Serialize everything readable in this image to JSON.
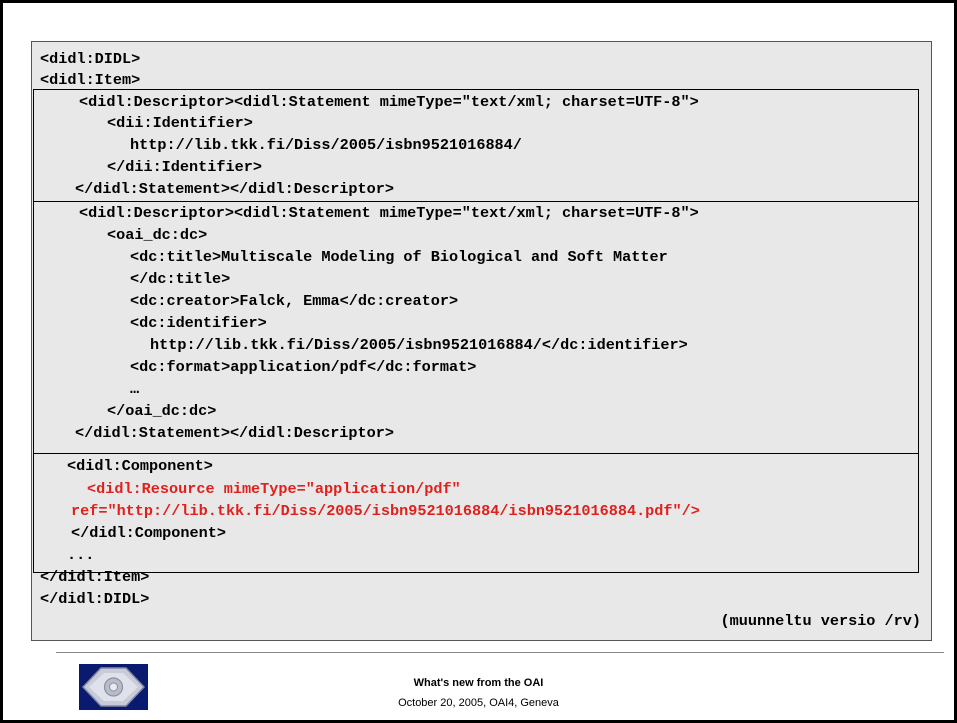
{
  "slide": {
    "code_lines": [
      {
        "text": "<didl:DIDL>",
        "color": "#000000"
      },
      {
        "text": "<didl:Item>",
        "color": "#000000"
      },
      {
        "text": "<didl:Descriptor><didl:Statement mimeType=\"text/xml; charset=UTF-8\">",
        "color": "#000000"
      },
      {
        "text": "<dii:Identifier>",
        "color": "#000000"
      },
      {
        "text": "http://lib.tkk.fi/Diss/2005/isbn9521016884/",
        "color": "#000000"
      },
      {
        "text": "</dii:Identifier>",
        "color": "#000000"
      },
      {
        "text": "</didl:Statement></didl:Descriptor>",
        "color": "#000000"
      },
      {
        "text": "<didl:Descriptor><didl:Statement mimeType=\"text/xml; charset=UTF-8\">",
        "color": "#000000"
      },
      {
        "text": "<oai_dc:dc>",
        "color": "#000000"
      },
      {
        "text": "<dc:title>Multiscale Modeling of Biological and Soft Matter",
        "color": "#000000"
      },
      {
        "text": "</dc:title>",
        "color": "#000000"
      },
      {
        "text": "<dc:creator>Falck, Emma</dc:creator>",
        "color": "#000000"
      },
      {
        "text": "<dc:identifier>",
        "color": "#000000"
      },
      {
        "text": "http://lib.tkk.fi/Diss/2005/isbn9521016884/</dc:identifier>",
        "color": "#000000"
      },
      {
        "text": "<dc:format>application/pdf</dc:format>",
        "color": "#000000"
      },
      {
        "text": "…",
        "color": "#000000"
      },
      {
        "text": "</oai_dc:dc>",
        "color": "#000000"
      },
      {
        "text": "</didl:Statement></didl:Descriptor>",
        "color": "#000000"
      },
      {
        "text": "<didl:Component>",
        "color": "#000000"
      },
      {
        "text": "<didl:Resource mimeType=\"application/pdf\"",
        "color": "#e0201c"
      },
      {
        "text": "ref=\"http://lib.tkk.fi/Diss/2005/isbn9521016884/isbn9521016884.pdf\"/>",
        "color": "#e0201c"
      },
      {
        "text": "</didl:Component>",
        "color": "#000000"
      },
      {
        "text": "...",
        "color": "#000000"
      },
      {
        "text": "</didl:Item>",
        "color": "#000000"
      },
      {
        "text": "</didl:DIDL>",
        "color": "#000000"
      }
    ],
    "attribution": "(muunneltu versio /rv)"
  },
  "footer": {
    "title": "What's new from the OAI",
    "subtitle": "October 20, 2005, OAI4, Geneva",
    "logo_icon": "oai-logo-icon"
  }
}
